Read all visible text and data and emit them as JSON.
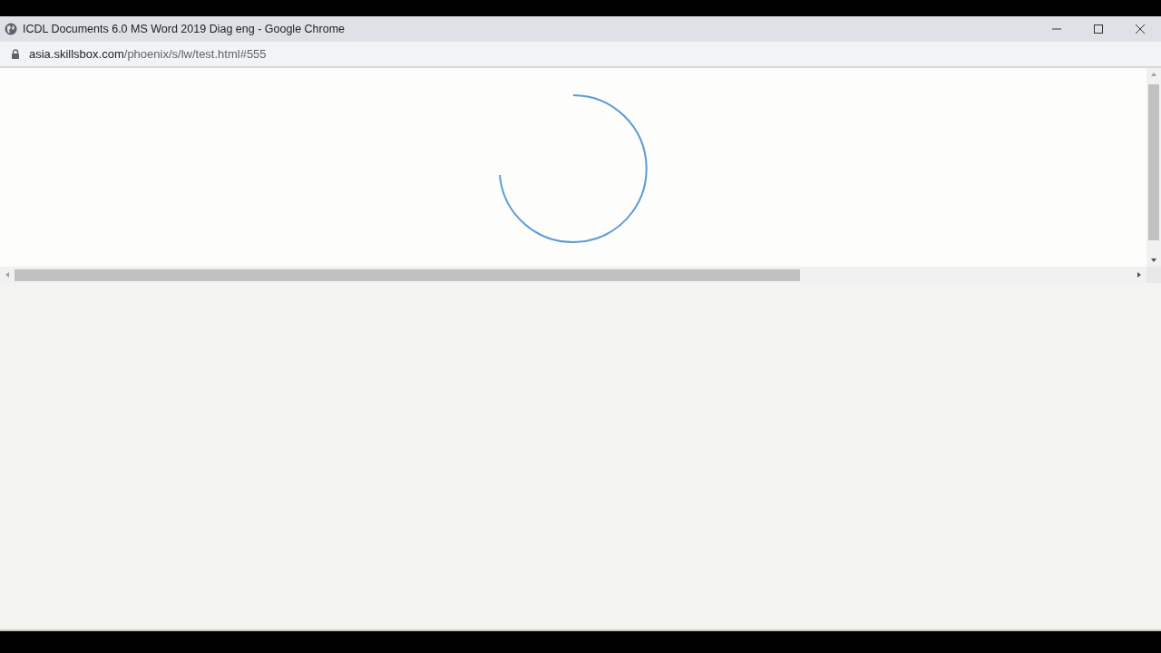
{
  "window": {
    "title": "ICDL Documents 6.0 MS Word 2019 Diag eng - Google Chrome"
  },
  "address_bar": {
    "host": "asia.skillsbox.com",
    "path": "/phoenix/s/lw/test.html#555"
  }
}
